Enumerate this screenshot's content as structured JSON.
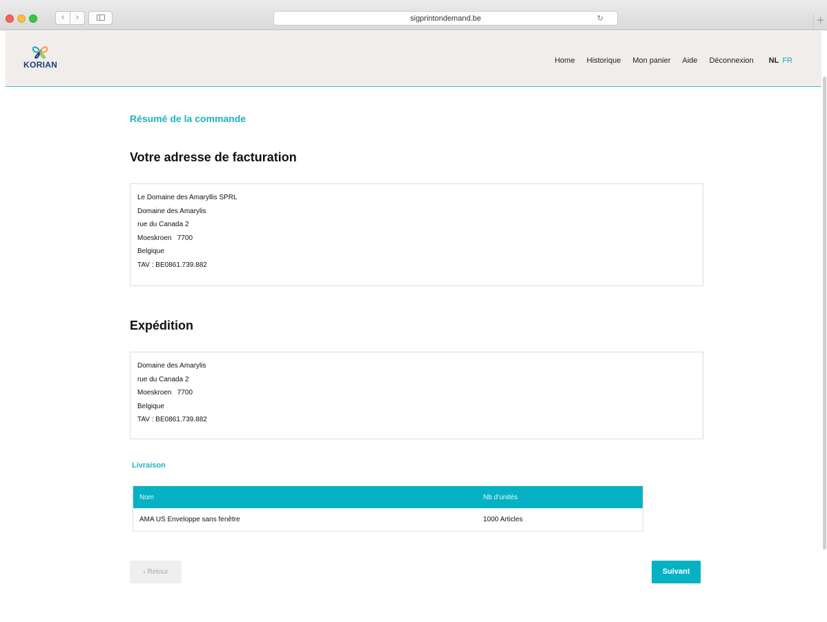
{
  "browser": {
    "url": "sigprintondemand.be",
    "back_glyph": "‹",
    "forward_glyph": "›",
    "reload_glyph": "↻",
    "newtab_glyph": "+"
  },
  "header": {
    "logo_text": "KORIAN",
    "nav": [
      "Home",
      "Historique",
      "Mon panier",
      "Aide",
      "Déconnexion"
    ],
    "lang_nl": "NL",
    "lang_fr": "FR"
  },
  "page": {
    "kicker": "Résumé de la commande",
    "billing_title": "Votre adresse de facturation",
    "billing_lines": [
      "Le Domaine des Amaryllis SPRL",
      "Domaine des Amarylis",
      "rue du Canada 2",
      "Moeskroen   7700",
      "Belgique",
      "TAV : BE0861.739.882"
    ],
    "shipping_title": "Expédition",
    "shipping_lines": [
      "Domaine des Amarylis",
      "rue du Canada 2",
      "Moeskroen   7700",
      "Belgique",
      "TAV : BE0861.739.882"
    ],
    "delivery_title": "Livraison",
    "table": {
      "headers": [
        "Nom",
        "Nb d'unités"
      ],
      "rows": [
        [
          "AMA US Enveloppe sans fenêtre",
          "1000 Articles"
        ]
      ]
    },
    "back_label": "‹ Retour",
    "next_label": "Suivant"
  },
  "colors": {
    "accent": "#07b1c4",
    "header_bg": "#f1edea",
    "logo_blue": "#1d3c78"
  },
  "icons": {
    "logo": "butterfly-logo-icon",
    "sidebar": "sidebar-icon",
    "reload": "reload-icon"
  }
}
